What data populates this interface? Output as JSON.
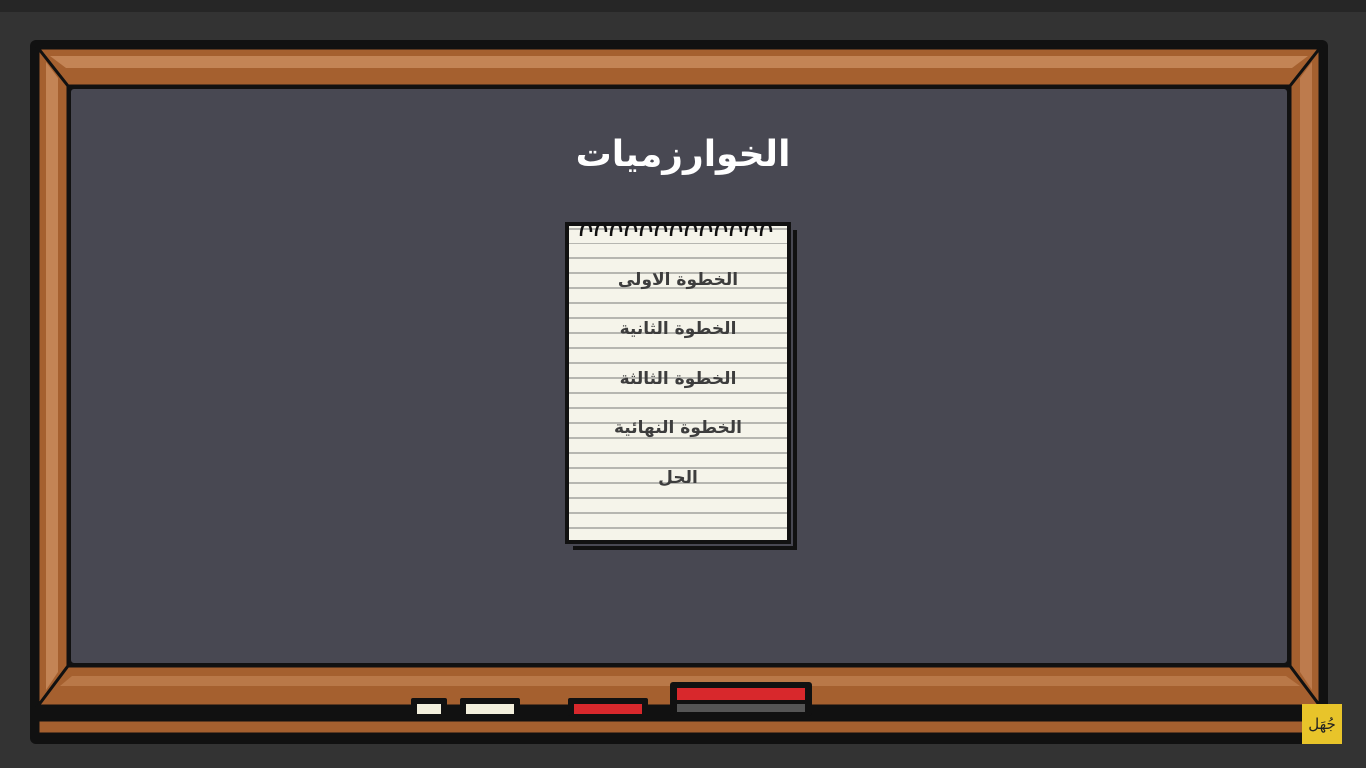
{
  "board": {
    "title": "الخوارزميات",
    "steps": [
      "الخطوة الاولى",
      "الخطوة الثانية",
      "الخطوة الثالثة",
      "الخطوة النهائية",
      "الحل"
    ]
  },
  "logo": {
    "text": "جُهَل"
  },
  "colors": {
    "background": "#333333",
    "frame_wood": "#a5602f",
    "frame_wood_light": "#c7885a",
    "chalkboard": "#484852",
    "paper": "#f5f4ea",
    "chalk_white": "#f2efdc",
    "chalk_red": "#d8282c",
    "logo_bg": "#e8c42a"
  }
}
